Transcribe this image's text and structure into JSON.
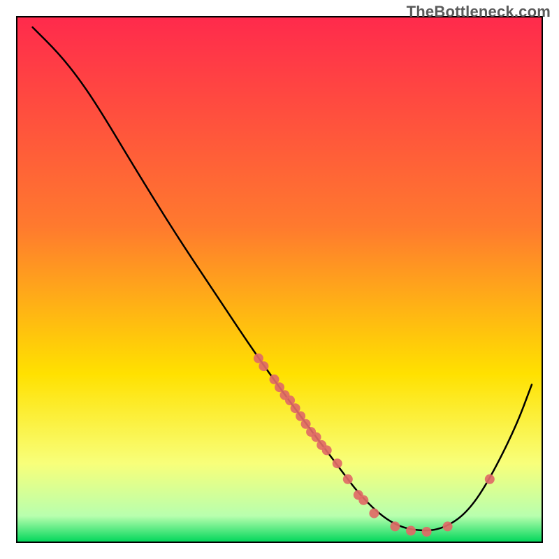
{
  "watermark": "TheBottleneck.com",
  "chart_data": {
    "type": "line",
    "title": "",
    "xlabel": "",
    "ylabel": "",
    "xlim": [
      0,
      100
    ],
    "ylim": [
      0,
      100
    ],
    "curve": [
      {
        "x": 3,
        "y": 98
      },
      {
        "x": 8,
        "y": 93
      },
      {
        "x": 12,
        "y": 88
      },
      {
        "x": 16,
        "y": 82
      },
      {
        "x": 22,
        "y": 72
      },
      {
        "x": 30,
        "y": 59
      },
      {
        "x": 38,
        "y": 47
      },
      {
        "x": 46,
        "y": 35
      },
      {
        "x": 54,
        "y": 24
      },
      {
        "x": 60,
        "y": 16
      },
      {
        "x": 66,
        "y": 8
      },
      {
        "x": 72,
        "y": 3
      },
      {
        "x": 78,
        "y": 2
      },
      {
        "x": 82,
        "y": 3
      },
      {
        "x": 86,
        "y": 6
      },
      {
        "x": 90,
        "y": 12
      },
      {
        "x": 95,
        "y": 22
      },
      {
        "x": 98,
        "y": 30
      }
    ],
    "markers": [
      {
        "x": 46,
        "y": 35
      },
      {
        "x": 47,
        "y": 33.5
      },
      {
        "x": 49,
        "y": 31
      },
      {
        "x": 50,
        "y": 29.5
      },
      {
        "x": 51,
        "y": 28
      },
      {
        "x": 52,
        "y": 27
      },
      {
        "x": 53,
        "y": 25.5
      },
      {
        "x": 54,
        "y": 24
      },
      {
        "x": 55,
        "y": 22.5
      },
      {
        "x": 56,
        "y": 21
      },
      {
        "x": 57,
        "y": 20
      },
      {
        "x": 58,
        "y": 18.5
      },
      {
        "x": 59,
        "y": 17.5
      },
      {
        "x": 61,
        "y": 15
      },
      {
        "x": 63,
        "y": 12
      },
      {
        "x": 65,
        "y": 9
      },
      {
        "x": 66,
        "y": 8
      },
      {
        "x": 68,
        "y": 5.5
      },
      {
        "x": 72,
        "y": 3
      },
      {
        "x": 75,
        "y": 2.2
      },
      {
        "x": 78,
        "y": 2
      },
      {
        "x": 82,
        "y": 3
      },
      {
        "x": 90,
        "y": 12
      }
    ],
    "background_gradient": {
      "top": "#ff2a4c",
      "mid1": "#ff7a2e",
      "mid2": "#ffe100",
      "low1": "#f8ff7a",
      "low2": "#b8ffae",
      "bottom": "#00d65a"
    }
  }
}
